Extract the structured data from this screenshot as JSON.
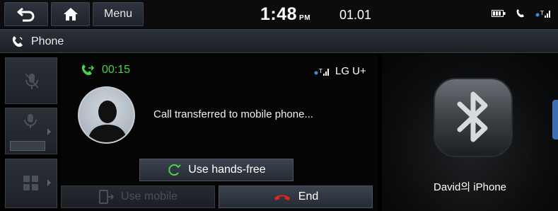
{
  "topbar": {
    "menu_label": "Menu",
    "time": "1:48",
    "ampm": "PM",
    "date": "01.01"
  },
  "titlebar": {
    "title": "Phone"
  },
  "call": {
    "duration": "00:15",
    "carrier": "LG U+",
    "message": "Call transferred to mobile phone...",
    "handsfree_label": "Use hands-free",
    "mobile_label": "Use mobile",
    "end_label": "End"
  },
  "device": {
    "name": "David의 iPhone"
  },
  "colors": {
    "accent_green": "#4cd04a",
    "end_red": "#e0261c",
    "bluetooth_blue": "#3a6fb3"
  }
}
